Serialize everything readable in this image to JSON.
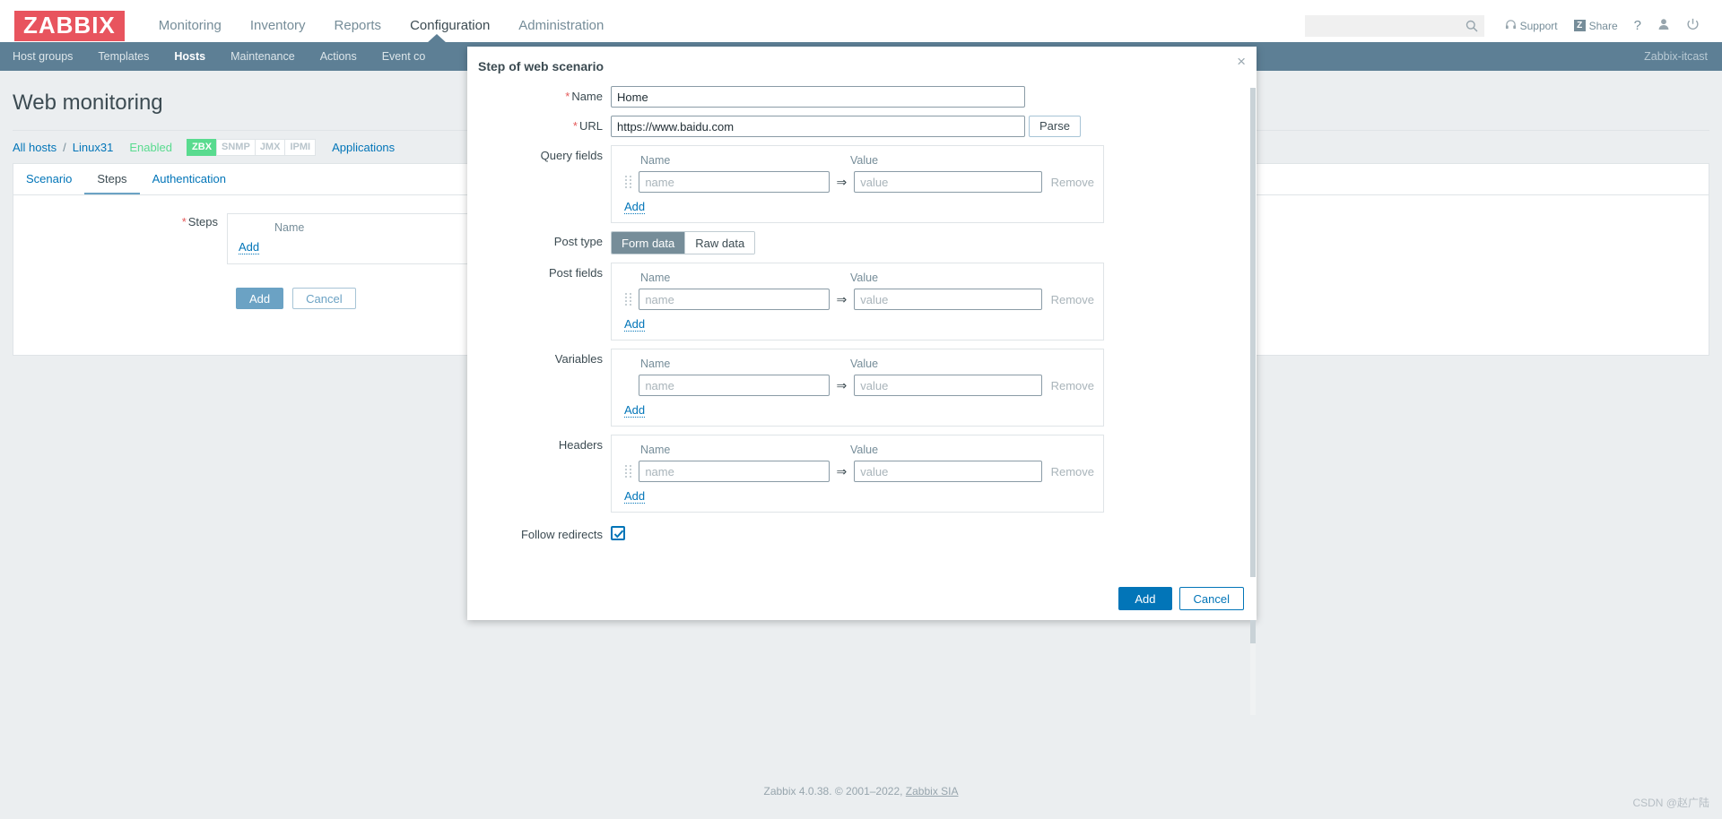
{
  "header": {
    "logo": "ZABBIX",
    "nav": [
      {
        "label": "Monitoring",
        "selected": false
      },
      {
        "label": "Inventory",
        "selected": false
      },
      {
        "label": "Reports",
        "selected": false
      },
      {
        "label": "Configuration",
        "selected": true
      },
      {
        "label": "Administration",
        "selected": false
      }
    ],
    "search_placeholder": "",
    "search_value": "",
    "support_label": "Support",
    "share_label": "Share",
    "share_badge": "Z",
    "help_label": "?"
  },
  "subnav": {
    "items": [
      {
        "label": "Host groups",
        "selected": false
      },
      {
        "label": "Templates",
        "selected": false
      },
      {
        "label": "Hosts",
        "selected": true
      },
      {
        "label": "Maintenance",
        "selected": false
      },
      {
        "label": "Actions",
        "selected": false
      },
      {
        "label": "Event co",
        "selected": false
      }
    ],
    "server": "Zabbix-itcast"
  },
  "page": {
    "title": "Web monitoring",
    "breadcrumb": {
      "all_hosts": "All hosts",
      "separator": "/",
      "host": "Linux31",
      "status": "Enabled",
      "tags": [
        {
          "label": "ZBX",
          "active": true
        },
        {
          "label": "SNMP",
          "active": false
        },
        {
          "label": "JMX",
          "active": false
        },
        {
          "label": "IPMI",
          "active": false
        }
      ],
      "applications": "Applications"
    },
    "tabs": [
      {
        "label": "Scenario",
        "selected": false
      },
      {
        "label": "Steps",
        "selected": true
      },
      {
        "label": "Authentication",
        "selected": false
      }
    ],
    "steps_label": "Steps",
    "steps_header_name": "Name",
    "steps_add": "Add",
    "buttons": {
      "add": "Add",
      "cancel": "Cancel"
    }
  },
  "modal": {
    "title": "Step of web scenario",
    "close": "×",
    "name_label": "Name",
    "name_value": "Home",
    "url_label": "URL",
    "url_value": "https://www.baidu.com",
    "parse_label": "Parse",
    "col_name": "Name",
    "col_value": "Value",
    "placeholder_name": "name",
    "placeholder_value": "value",
    "arrow": "⇒",
    "remove_label": "Remove",
    "add_label": "Add",
    "query_fields_label": "Query fields",
    "post_type_label": "Post type",
    "post_type_options": [
      {
        "label": "Form data",
        "selected": true
      },
      {
        "label": "Raw data",
        "selected": false
      }
    ],
    "post_fields_label": "Post fields",
    "variables_label": "Variables",
    "headers_label": "Headers",
    "follow_redirects_label": "Follow redirects",
    "follow_redirects_checked": true,
    "footer": {
      "add": "Add",
      "cancel": "Cancel"
    }
  },
  "footer": {
    "text": "Zabbix 4.0.38. © 2001–2022, ",
    "link": "Zabbix SIA",
    "watermark": "CSDN @赵广陆"
  },
  "colors": {
    "logo_red": "#e8545e",
    "subnav_blue": "#5d7f95",
    "link_blue": "#0275b8",
    "enabled_green": "#59db8f",
    "required_red": "#e45959"
  }
}
